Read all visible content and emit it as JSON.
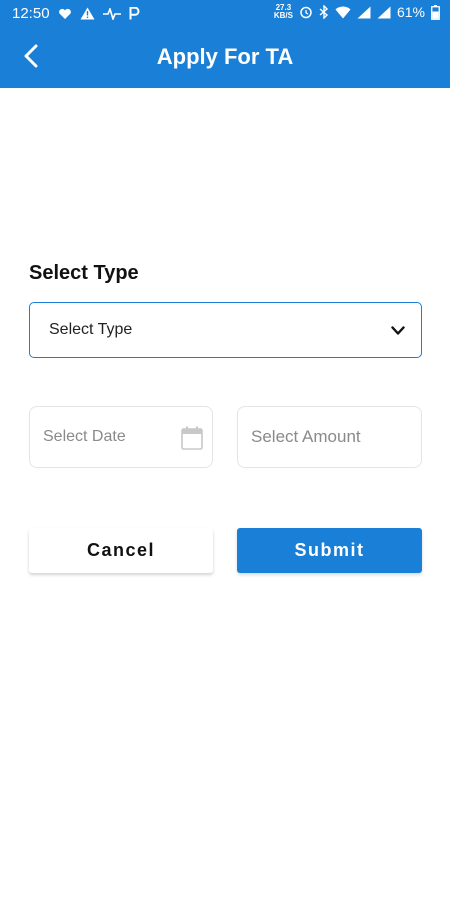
{
  "status_bar": {
    "time": "12:50",
    "network_speed_value": "27.3",
    "network_speed_unit": "KB/S",
    "battery_percent": "61%"
  },
  "header": {
    "title": "Apply For TA",
    "back_icon": "chevron-left-icon"
  },
  "form": {
    "type_label": "Select Type",
    "type_select": {
      "selected_text": "Select Type",
      "icon": "chevron-down-icon"
    },
    "date_field": {
      "placeholder": "Select Date",
      "icon": "calendar-icon"
    },
    "amount_field": {
      "placeholder": "Select Amount"
    },
    "cancel_label": "Cancel",
    "submit_label": "Submit"
  },
  "colors": {
    "primary": "#1a7fd6",
    "background": "#ffffff",
    "text": "#111111",
    "placeholder": "#8a8a8a"
  }
}
